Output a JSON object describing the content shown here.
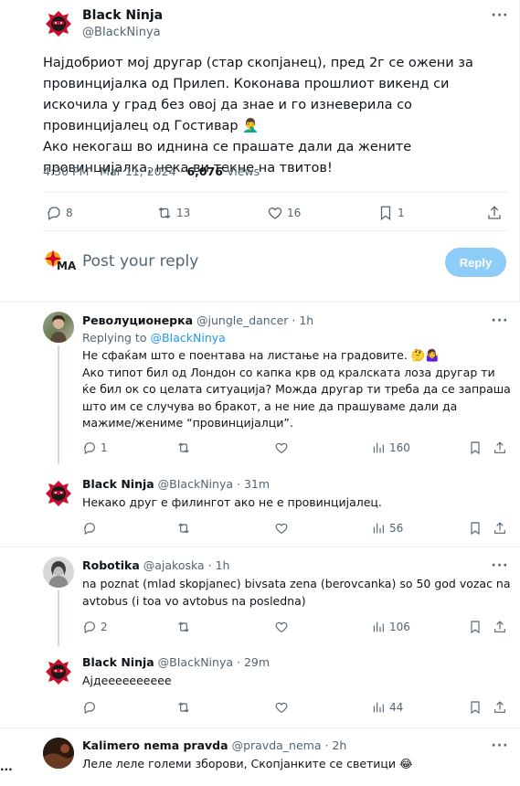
{
  "main_tweet": {
    "author_name": "Black Ninja",
    "author_handle": "@BIackNinya",
    "text": "Најдобриот мој другар (стар скопјанец), пред 2г се ожени за провинцијалка од Прилеп. Коконава прошлиот викенд си искочила у град без овој да знае и го изневерила со провинцијалец од Гостивар 🤦‍♂️\nАко некогаш во иднина се прашате дали да жените провинцијалка, нека ви текне на твитов!",
    "time": "4:30 PM",
    "date": "Mar 11, 2024",
    "views_count": "6,076",
    "views_label": "Views",
    "replies": "8",
    "reposts": "13",
    "likes": "16",
    "bookmarks": "1"
  },
  "reply_box": {
    "placeholder": "Post your reply",
    "button_label": "Reply"
  },
  "replies": [
    {
      "name": "Револуционерка",
      "handle": "@jungle_dancer",
      "age": "1h",
      "replying_prefix": "Replying to",
      "replying_to": "@BIackNinya",
      "text": "Не сфаќам што е поентава на листање на градовите. 🤔🤷‍♀️\nАко типот бил од Лондон со капка крв од кралската лоза другар ти ќе бил ок со целата ситуација? Можда другар ти треба да се запраша што им се случува во бракот, а не ние да прашуваме дали да мажиме/жениме “провинцијалци”.",
      "replies": "1",
      "views": "160"
    },
    {
      "name": "Black Ninja",
      "handle": "@BIackNinya",
      "age": "31m",
      "text": "Некако друг е филингот ако не е провинцијалец.",
      "views": "56"
    },
    {
      "name": "Robotika",
      "handle": "@ajakoska",
      "age": "1h",
      "text": "na poznat (mlad skopjanec) bivsata zena (berovcanka) so 50 god vozac na avtobus (i toa vo avtobus na poslednа)",
      "replies": "2",
      "views": "106"
    },
    {
      "name": "Black Ninja",
      "handle": "@BIackNinya",
      "age": "29m",
      "text": "Ајдееееееееее",
      "views": "44"
    },
    {
      "name": "Kalimero nema pravda",
      "handle": "@pravda_nema",
      "age": "2h",
      "text": "Леле леле големи зборови, Скопјанките се светици 😂"
    }
  ],
  "side_text": "...",
  "colors": {
    "accent": "#1d9bf0",
    "reply_button_disabled": "#8ecdf7",
    "ninja_red": "#c8102e"
  }
}
